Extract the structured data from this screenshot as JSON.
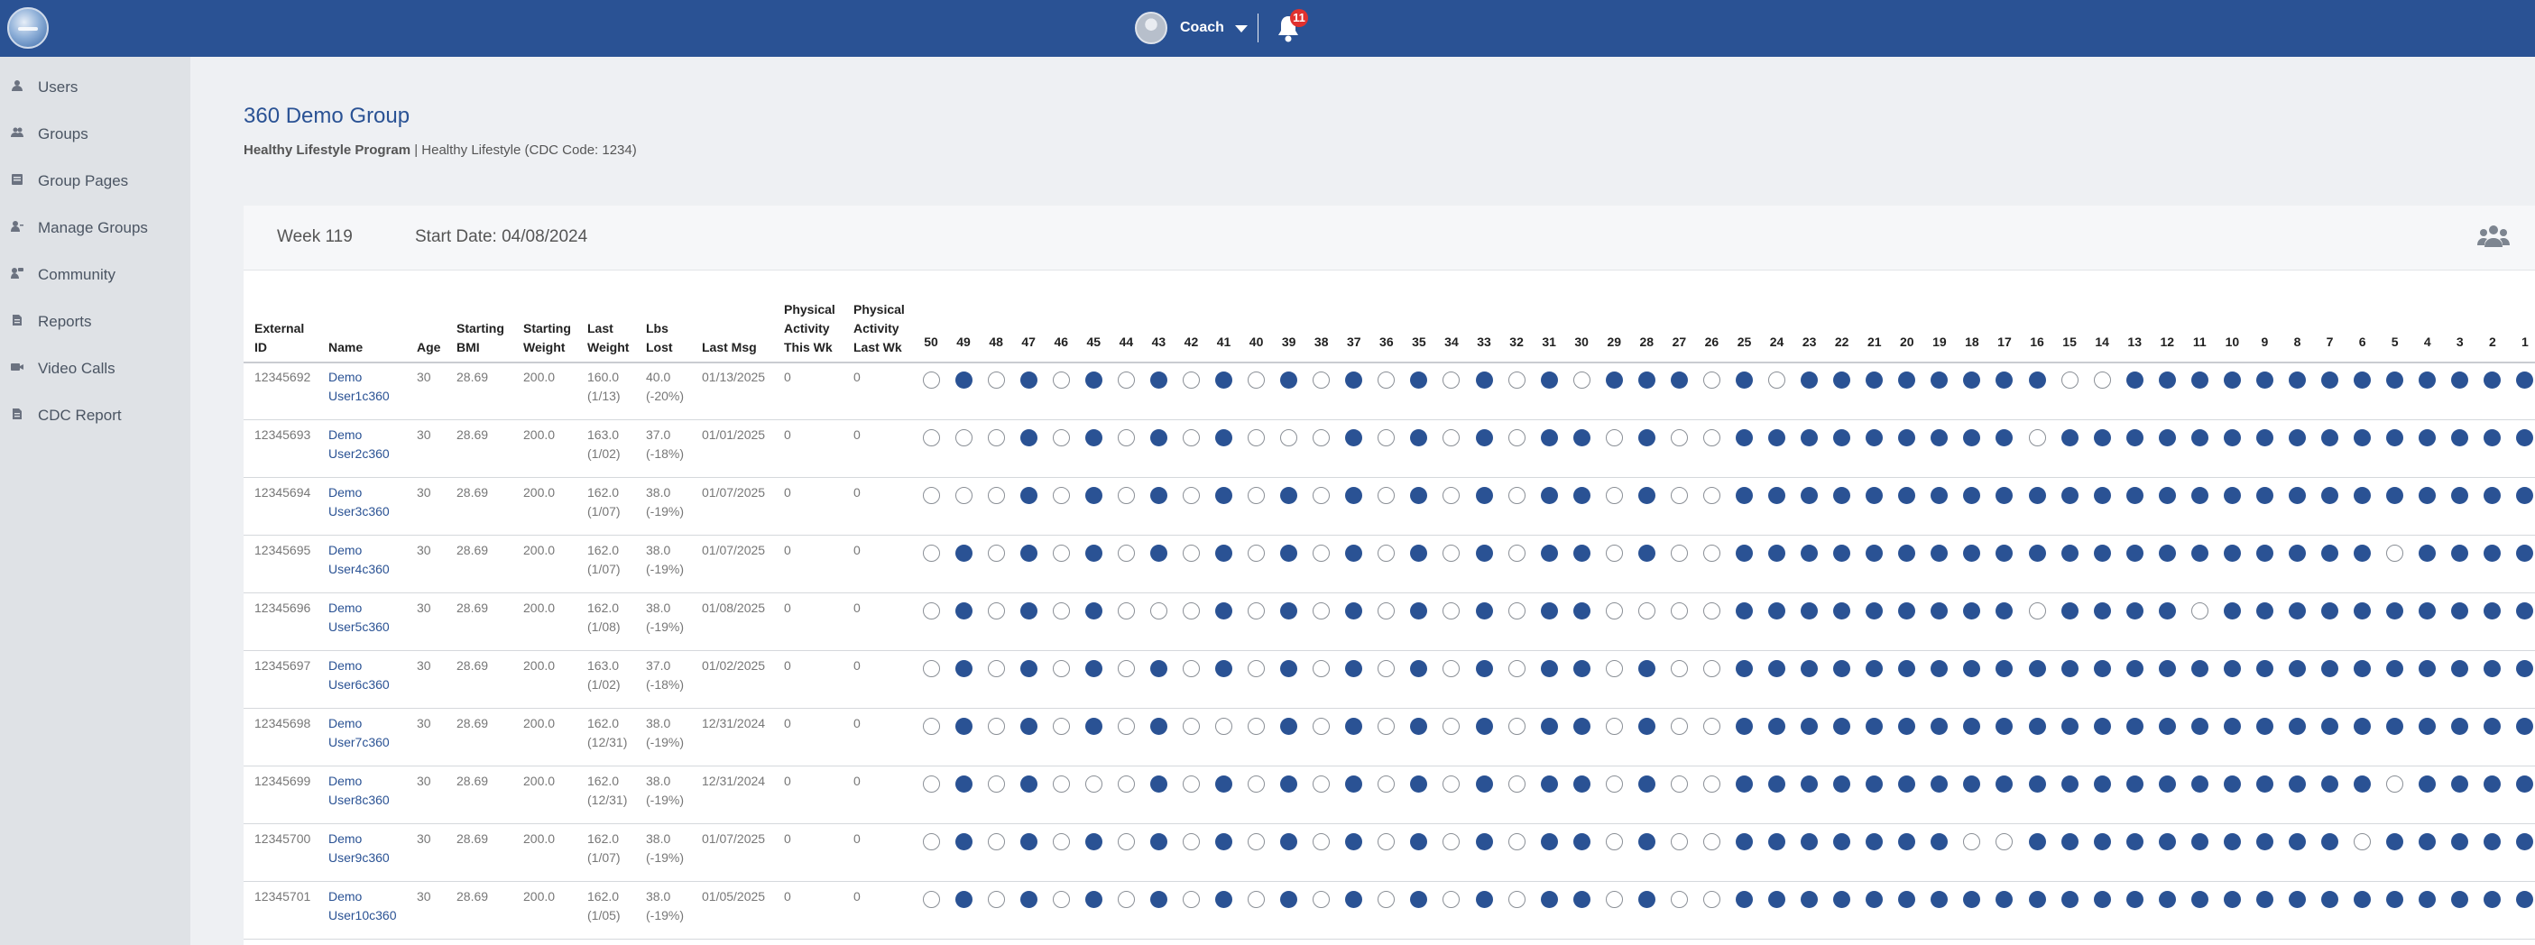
{
  "topbar": {
    "user_name": "Coach",
    "notification_count": "11",
    "brand_color": "#2a5294"
  },
  "sidebar": {
    "items": [
      {
        "label": "Users",
        "icon": "user-icon"
      },
      {
        "label": "Groups",
        "icon": "users-icon"
      },
      {
        "label": "Group Pages",
        "icon": "page-icon"
      },
      {
        "label": "Manage Groups",
        "icon": "manage-users-icon"
      },
      {
        "label": "Community",
        "icon": "community-icon"
      },
      {
        "label": "Reports",
        "icon": "report-icon"
      },
      {
        "label": "Video Calls",
        "icon": "video-icon"
      },
      {
        "label": "CDC Report",
        "icon": "report-icon"
      }
    ]
  },
  "group": {
    "title": "360 Demo Group",
    "program": "Healthy Lifestyle Program",
    "subtitle_rest": " | Healthy Lifestyle (CDC Code: 1234)"
  },
  "card": {
    "week": "Week 119",
    "start_date": "Start Date: 04/08/2024"
  },
  "table": {
    "headers": {
      "external_id": [
        "External",
        "ID"
      ],
      "name": [
        "Name"
      ],
      "age": [
        "Age"
      ],
      "starting_bmi": [
        "Starting",
        "BMI"
      ],
      "starting_weight": [
        "Starting",
        "Weight"
      ],
      "last_weight": [
        "Last",
        "Weight"
      ],
      "lbs_lost": [
        "Lbs",
        "Lost"
      ],
      "last_msg": [
        "Last Msg"
      ],
      "pa_this_wk": [
        "Physical",
        "Activity",
        "This Wk"
      ],
      "pa_last_wk": [
        "Physical",
        "Activity",
        "Last Wk"
      ]
    },
    "weeks": [
      50,
      49,
      48,
      47,
      46,
      45,
      44,
      43,
      42,
      41,
      40,
      39,
      38,
      37,
      36,
      35,
      34,
      33,
      32,
      31,
      30,
      29,
      28,
      27,
      26,
      25,
      24,
      23,
      22,
      21,
      20,
      19,
      18,
      17,
      16,
      15,
      14,
      13,
      12,
      11,
      10,
      9,
      8,
      7,
      6,
      5,
      4,
      3,
      2,
      1
    ],
    "rows": [
      {
        "id": "12345692",
        "name": [
          "Demo",
          "User1c360"
        ],
        "age": "30",
        "bmi": "28.69",
        "start_weight": "200.0",
        "last_weight": [
          "160.0",
          "(1/13)"
        ],
        "lbs_lost": [
          "40.0",
          "(-20%)"
        ],
        "last_msg": "01/13/2025",
        "pa_this": "0",
        "pa_last": "0",
        "weeks": "01010101010101010101011101011111111001111111111111"
      },
      {
        "id": "12345693",
        "name": [
          "Demo",
          "User2c360"
        ],
        "age": "30",
        "bmi": "28.69",
        "start_weight": "200.0",
        "last_weight": [
          "163.0",
          "(1/02)"
        ],
        "lbs_lost": [
          "37.0",
          "(-18%)"
        ],
        "last_msg": "01/01/2025",
        "pa_this": "0",
        "pa_last": "0",
        "weeks": "00010101010001010101101001111111110111111111111111"
      },
      {
        "id": "12345694",
        "name": [
          "Demo",
          "User3c360"
        ],
        "age": "30",
        "bmi": "28.69",
        "start_weight": "200.0",
        "last_weight": [
          "162.0",
          "(1/07)"
        ],
        "lbs_lost": [
          "38.0",
          "(-19%)"
        ],
        "last_msg": "01/07/2025",
        "pa_this": "0",
        "pa_last": "0",
        "weeks": "00010101010101010101101001111111111111111111111111"
      },
      {
        "id": "12345695",
        "name": [
          "Demo",
          "User4c360"
        ],
        "age": "30",
        "bmi": "28.69",
        "start_weight": "200.0",
        "last_weight": [
          "162.0",
          "(1/07)"
        ],
        "lbs_lost": [
          "38.0",
          "(-19%)"
        ],
        "last_msg": "01/07/2025",
        "pa_this": "0",
        "pa_last": "0",
        "weeks": "01010101010101010101101001111111111111111111101111"
      },
      {
        "id": "12345696",
        "name": [
          "Demo",
          "User5c360"
        ],
        "age": "30",
        "bmi": "28.69",
        "start_weight": "200.0",
        "last_weight": [
          "162.0",
          "(1/08)"
        ],
        "lbs_lost": [
          "38.0",
          "(-19%)"
        ],
        "last_msg": "01/08/2025",
        "pa_this": "0",
        "pa_last": "0",
        "weeks": "01010100010101010101100001111111110111101111111111"
      },
      {
        "id": "12345697",
        "name": [
          "Demo",
          "User6c360"
        ],
        "age": "30",
        "bmi": "28.69",
        "start_weight": "200.0",
        "last_weight": [
          "163.0",
          "(1/02)"
        ],
        "lbs_lost": [
          "37.0",
          "(-18%)"
        ],
        "last_msg": "01/02/2025",
        "pa_this": "0",
        "pa_last": "0",
        "weeks": "01010101010101010101101001111111111111111111111111"
      },
      {
        "id": "12345698",
        "name": [
          "Demo",
          "User7c360"
        ],
        "age": "30",
        "bmi": "28.69",
        "start_weight": "200.0",
        "last_weight": [
          "162.0",
          "(12/31)"
        ],
        "lbs_lost": [
          "38.0",
          "(-19%)"
        ],
        "last_msg": "12/31/2024",
        "pa_this": "0",
        "pa_last": "0",
        "weeks": "01010101000101010101101001111111111111111111111111"
      },
      {
        "id": "12345699",
        "name": [
          "Demo",
          "User8c360"
        ],
        "age": "30",
        "bmi": "28.69",
        "start_weight": "200.0",
        "last_weight": [
          "162.0",
          "(12/31)"
        ],
        "lbs_lost": [
          "38.0",
          "(-19%)"
        ],
        "last_msg": "12/31/2024",
        "pa_this": "0",
        "pa_last": "0",
        "weeks": "01010001010101010101101001111111111111111111101111"
      },
      {
        "id": "12345700",
        "name": [
          "Demo",
          "User9c360"
        ],
        "age": "30",
        "bmi": "28.69",
        "start_weight": "200.0",
        "last_weight": [
          "162.0",
          "(1/07)"
        ],
        "lbs_lost": [
          "38.0",
          "(-19%)"
        ],
        "last_msg": "01/07/2025",
        "pa_this": "0",
        "pa_last": "0",
        "weeks": "01010101010101010101101001111111001111111111011111"
      },
      {
        "id": "12345701",
        "name": [
          "Demo",
          "User10c360"
        ],
        "age": "30",
        "bmi": "28.69",
        "start_weight": "200.0",
        "last_weight": [
          "162.0",
          "(1/05)"
        ],
        "lbs_lost": [
          "38.0",
          "(-19%)"
        ],
        "last_msg": "01/05/2025",
        "pa_this": "0",
        "pa_last": "0",
        "weeks": "01010101010101010101101001111111111111111111111111"
      }
    ]
  }
}
